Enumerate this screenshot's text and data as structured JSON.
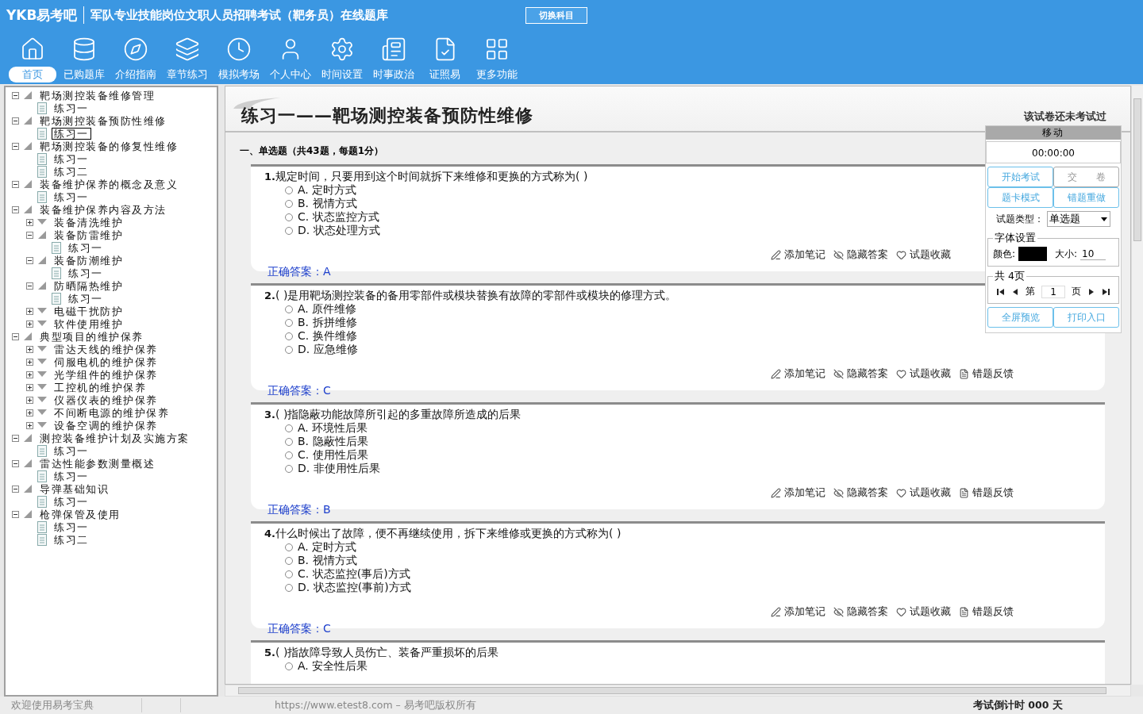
{
  "app": {
    "logo": "YKB易考吧",
    "title": "军队专业技能岗位文职人员招聘考试（靶务员）在线题库",
    "switch_button": "切换科目"
  },
  "toolbar": [
    {
      "label": "首页",
      "selected": true
    },
    {
      "label": "已购题库",
      "selected": false
    },
    {
      "label": "介绍指南",
      "selected": false
    },
    {
      "label": "章节练习",
      "selected": false
    },
    {
      "label": "模拟考场",
      "selected": false
    },
    {
      "label": "个人中心",
      "selected": false
    },
    {
      "label": "时间设置",
      "selected": false
    },
    {
      "label": "时事政治",
      "selected": false
    },
    {
      "label": "证照易",
      "selected": false
    },
    {
      "label": "更多功能",
      "selected": false
    }
  ],
  "tree": [
    {
      "label": "靶场测控装备维修管理",
      "expanded": true,
      "selected": false,
      "children": [
        {
          "label": "练习一",
          "selected": false
        }
      ]
    },
    {
      "label": "靶场测控装备预防性维修",
      "expanded": true,
      "selected": false,
      "children": [
        {
          "label": "练习一",
          "selected": true
        }
      ]
    },
    {
      "label": "靶场测控装备的修复性维修",
      "expanded": true,
      "selected": false,
      "children": [
        {
          "label": "练习一",
          "selected": false
        },
        {
          "label": "练习二",
          "selected": false
        }
      ]
    },
    {
      "label": "装备维护保养的概念及意义",
      "expanded": true,
      "selected": false,
      "children": [
        {
          "label": "练习一",
          "selected": false
        }
      ]
    },
    {
      "label": "装备维护保养内容及方法",
      "expanded": true,
      "selected": false,
      "children": [
        {
          "label": "装备清洗维护",
          "expanded": false,
          "selected": false
        },
        {
          "label": "装备防雷维护",
          "expanded": true,
          "selected": false,
          "children": [
            {
              "label": "练习一",
              "selected": false
            }
          ]
        },
        {
          "label": "装备防潮维护",
          "expanded": true,
          "selected": false,
          "children": [
            {
              "label": "练习一",
              "selected": false
            }
          ]
        },
        {
          "label": "防晒隔热维护",
          "expanded": true,
          "selected": false,
          "children": [
            {
              "label": "练习一",
              "selected": false
            }
          ]
        },
        {
          "label": "电磁干扰防护",
          "expanded": false,
          "selected": false
        },
        {
          "label": "软件使用维护",
          "expanded": false,
          "selected": false
        }
      ]
    },
    {
      "label": "典型项目的维护保养",
      "expanded": true,
      "selected": false,
      "children": [
        {
          "label": "雷达天线的维护保养",
          "expanded": false,
          "selected": false
        },
        {
          "label": "伺服电机的维护保养",
          "expanded": false,
          "selected": false
        },
        {
          "label": "光学组件的维护保养",
          "expanded": false,
          "selected": false
        },
        {
          "label": "工控机的维护保养",
          "expanded": false,
          "selected": false
        },
        {
          "label": "仪器仪表的维护保养",
          "expanded": false,
          "selected": false
        },
        {
          "label": "不间断电源的维护保养",
          "expanded": false,
          "selected": false
        },
        {
          "label": "设备空调的维护保养",
          "expanded": false,
          "selected": false
        }
      ]
    },
    {
      "label": "测控装备维护计划及实施方案",
      "expanded": true,
      "selected": false,
      "children": [
        {
          "label": "练习一",
          "selected": false
        }
      ]
    },
    {
      "label": "雷达性能参数测量概述",
      "expanded": true,
      "selected": false,
      "children": [
        {
          "label": "练习一",
          "selected": false
        }
      ]
    },
    {
      "label": "导弹基础知识",
      "expanded": true,
      "selected": false,
      "children": [
        {
          "label": "练习一",
          "selected": false
        }
      ]
    },
    {
      "label": "枪弹保管及使用",
      "expanded": true,
      "selected": false,
      "children": [
        {
          "label": "练习一",
          "selected": false
        },
        {
          "label": "练习二",
          "selected": false
        }
      ]
    }
  ],
  "exam": {
    "title": "练习一——靶场测控装备预防性维修",
    "status": "该试卷还未考试过",
    "section": "一、单选题（共43题，每题1分）",
    "questions": [
      {
        "number": "1.",
        "text": "规定时间，只要用到这个时间就拆下来维修和更换的方式称为( )",
        "options": [
          {
            "label": "A. 定时方式",
            "selected": false
          },
          {
            "label": "B. 视情方式",
            "selected": false
          },
          {
            "label": "C. 状态监控方式",
            "selected": false
          },
          {
            "label": "D. 状态处理方式",
            "selected": false
          }
        ],
        "actions": [
          "添加笔记",
          "隐藏答案",
          "试题收藏"
        ],
        "answer_label": "正确答案：",
        "answer": "A"
      },
      {
        "number": "2.",
        "text": "( )是用靶场测控装备的备用零部件或模块替换有故障的零部件或模块的修理方式。",
        "options": [
          {
            "label": "A. 原件维修",
            "selected": false
          },
          {
            "label": "B. 拆拼维修",
            "selected": false
          },
          {
            "label": "C. 换件维修",
            "selected": false
          },
          {
            "label": "D. 应急维修",
            "selected": false
          }
        ],
        "actions": [
          "添加笔记",
          "隐藏答案",
          "试题收藏",
          "错题反馈"
        ],
        "answer_label": "正确答案：",
        "answer": "C"
      },
      {
        "number": "3.",
        "text": "( )指隐蔽功能故障所引起的多重故障所造成的后果",
        "options": [
          {
            "label": "A. 环境性后果",
            "selected": false
          },
          {
            "label": "B. 隐蔽性后果",
            "selected": false
          },
          {
            "label": "C. 使用性后果",
            "selected": false
          },
          {
            "label": "D. 非使用性后果",
            "selected": false
          }
        ],
        "actions": [
          "添加笔记",
          "隐藏答案",
          "试题收藏",
          "错题反馈"
        ],
        "answer_label": "正确答案：",
        "answer": "B"
      },
      {
        "number": "4.",
        "text": "什么时候出了故障，便不再继续使用，拆下来维修或更换的方式称为( )",
        "options": [
          {
            "label": "A. 定时方式",
            "selected": false
          },
          {
            "label": "B. 视情方式",
            "selected": false
          },
          {
            "label": "C. 状态监控(事后)方式",
            "selected": false
          },
          {
            "label": "D. 状态监控(事前)方式",
            "selected": false
          }
        ],
        "actions": [
          "添加笔记",
          "隐藏答案",
          "试题收藏",
          "错题反馈"
        ],
        "answer_label": "正确答案：",
        "answer": "C"
      },
      {
        "number": "5.",
        "text": "( )指故障导致人员伤亡、装备严重损坏的后果",
        "options": [
          {
            "label": "A. 安全性后果",
            "selected": false
          }
        ]
      }
    ]
  },
  "panel": {
    "header": "移动",
    "timer": "00:00:00",
    "start_button": "开始考试",
    "submit_button": "交　　卷",
    "card_mode_button": "题卡模式",
    "redo_button": "错题重做",
    "type_label": "试题类型：",
    "type_value": "单选题",
    "font_legend": "字体设置",
    "color_label": "颜色:",
    "color": "#000000",
    "size_label": "大小:",
    "size_value": "10",
    "pages_legend": "共 4页",
    "page_prefix": "第",
    "page_value": "1",
    "page_suffix": "页",
    "preview_button": "全屏预览",
    "print_button": "打印入口"
  },
  "status_bar": {
    "welcome": "欢迎使用易考宝典",
    "copyright": "https://www.etest8.com – 易考吧版权所有",
    "countdown": "考试倒计时 000 天"
  }
}
